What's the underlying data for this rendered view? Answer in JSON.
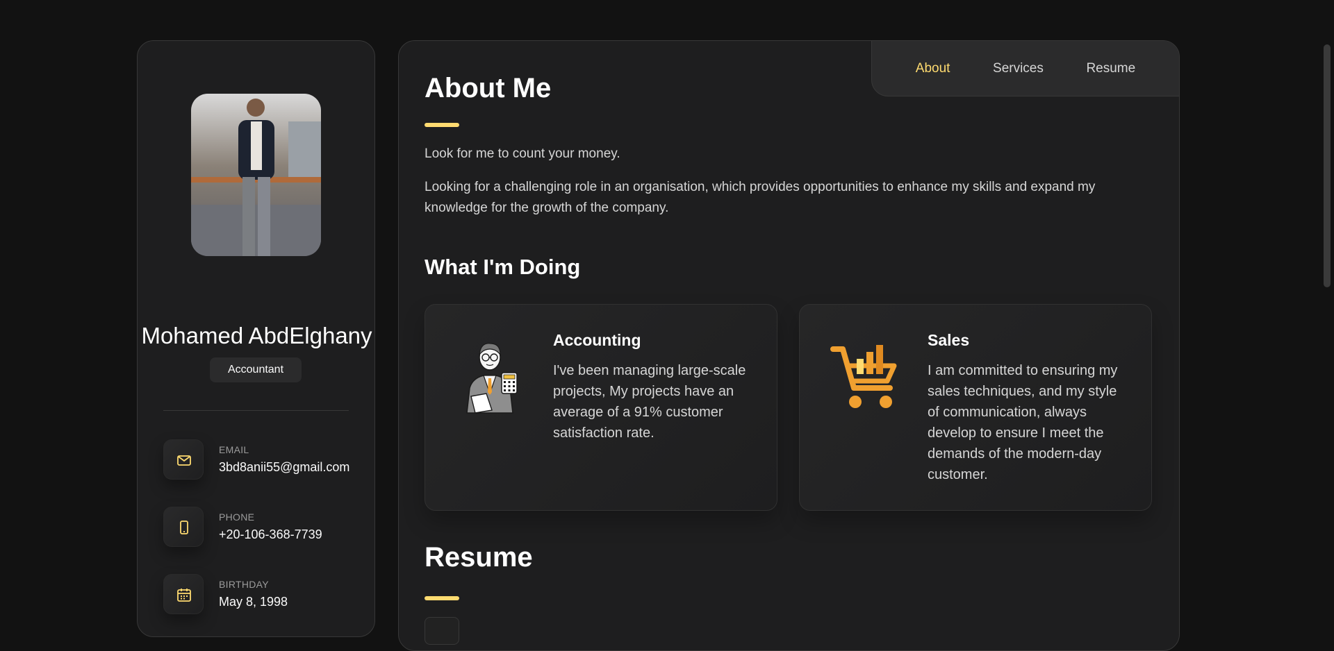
{
  "profile": {
    "name": "Mohamed AbdElghany",
    "title": "Accountant"
  },
  "contacts": [
    {
      "label": "EMAIL",
      "value": "3bd8anii55@gmail.com",
      "icon": "mail-icon"
    },
    {
      "label": "PHONE",
      "value": "+20-106-368-7739",
      "icon": "phone-icon"
    },
    {
      "label": "BIRTHDAY",
      "value": "May 8, 1998",
      "icon": "calendar-icon"
    }
  ],
  "nav": {
    "about": "About",
    "services": "Services",
    "resume": "Resume"
  },
  "about": {
    "heading": "About Me",
    "tagline": "Look for me to count your money.",
    "description": "Looking for a challenging role in an organisation, which provides opportunities to enhance my skills and expand my knowledge for the growth of the company."
  },
  "doing": {
    "heading": "What I'm Doing",
    "services": [
      {
        "title": "Accounting",
        "text": "I've been managing large-scale projects, My projects have an average of a 91% customer satisfaction rate.",
        "icon": "accountant-illustration-icon"
      },
      {
        "title": "Sales",
        "text": "I am committed to ensuring my sales techniques, and my style of communication, always develop to ensure I meet the demands of the modern-day customer.",
        "icon": "shopping-cart-chart-icon"
      }
    ]
  },
  "resume": {
    "heading": "Resume"
  },
  "colors": {
    "accent": "#ffdb70",
    "background": "#121212",
    "panel": "#1e1e1f",
    "cart": "#f0a030"
  }
}
